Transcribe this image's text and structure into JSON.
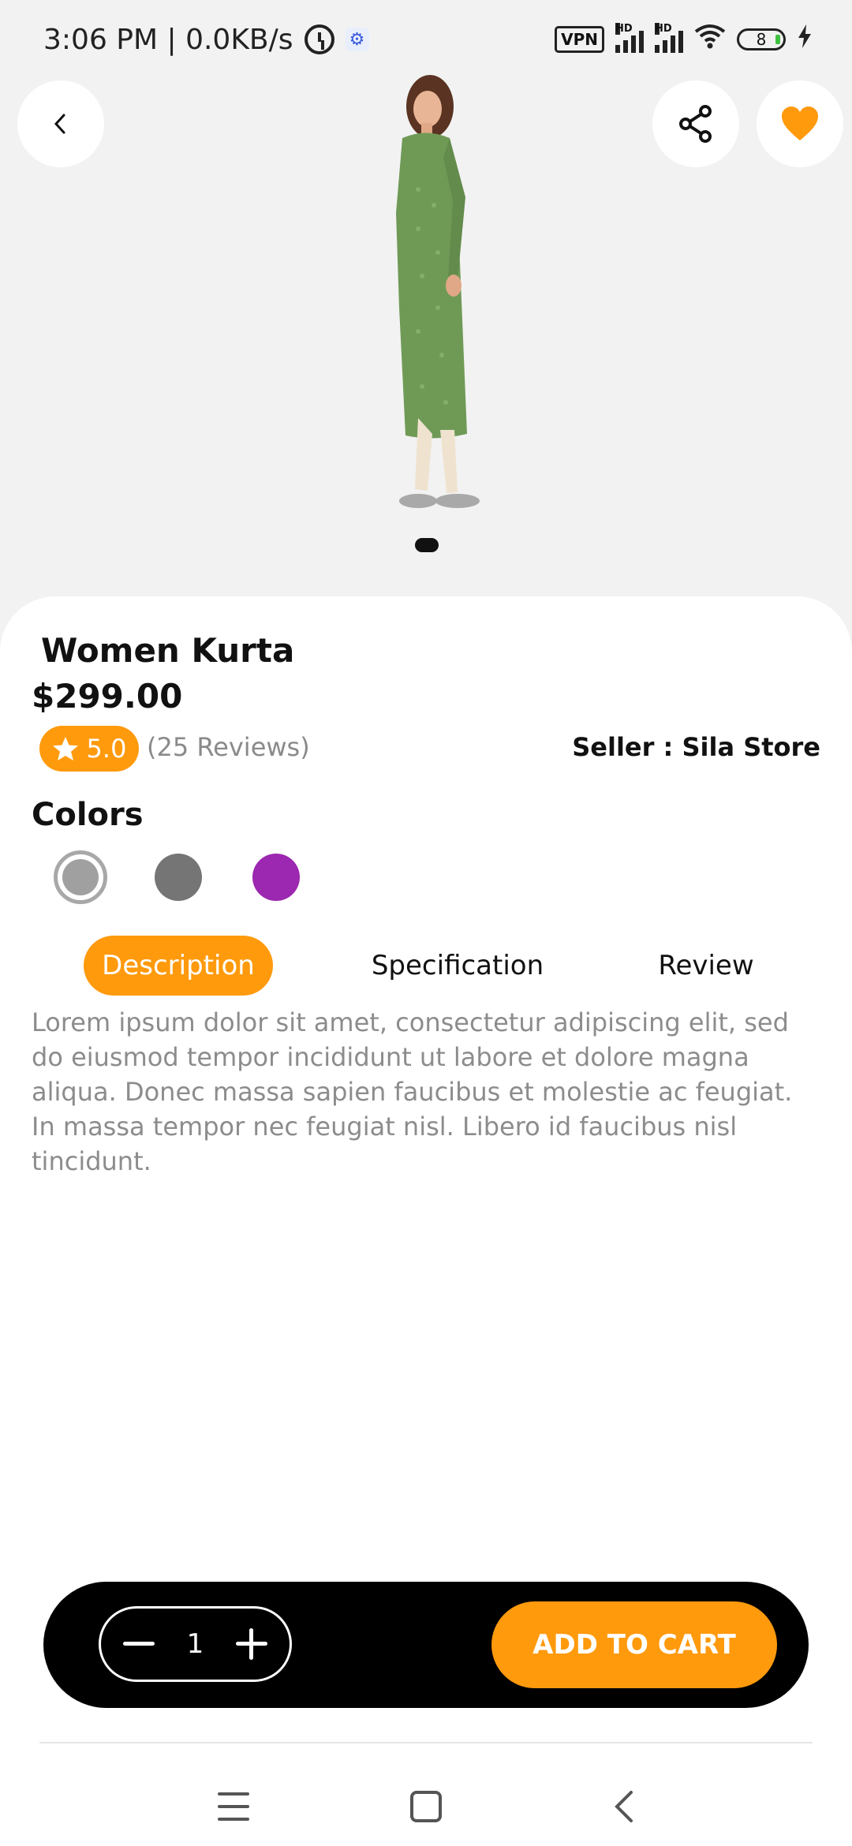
{
  "status_bar": {
    "time_speed": "3:06 PM | 0.0KB/s",
    "vpn": "VPN",
    "hd1": "HD",
    "hd2": "HD",
    "battery": "8"
  },
  "product": {
    "title": "Women Kurta",
    "price": "$299.00",
    "rating": "5.0",
    "reviews": "(25 Reviews)",
    "seller": "Seller : Sila Store",
    "image_pages": 1,
    "active_image": 1
  },
  "colors": {
    "label": "Colors",
    "options": [
      "#a0a0a0",
      "#757575",
      "#9c27b0"
    ],
    "selected": 0
  },
  "tabs": {
    "description": "Description",
    "specification": "Specification",
    "review": "Review",
    "active": "Description"
  },
  "description_text": "Lorem ipsum dolor sit amet, consectetur adipiscing elit, sed do eiusmod tempor incididunt ut labore et dolore magna aliqua. Donec massa sapien faucibus et molestie ac feugiat. In massa tempor nec feugiat nisl. Libero id faucibus nisl tincidunt.",
  "cart": {
    "quantity": "1",
    "add_label": "ADD TO CART"
  },
  "icons": {
    "back": "chevron-left-icon",
    "share": "share-icon",
    "favorite": "heart-icon",
    "star": "star-icon"
  },
  "colors_theme": {
    "accent": "#ff9a0d",
    "bar": "#000000"
  }
}
